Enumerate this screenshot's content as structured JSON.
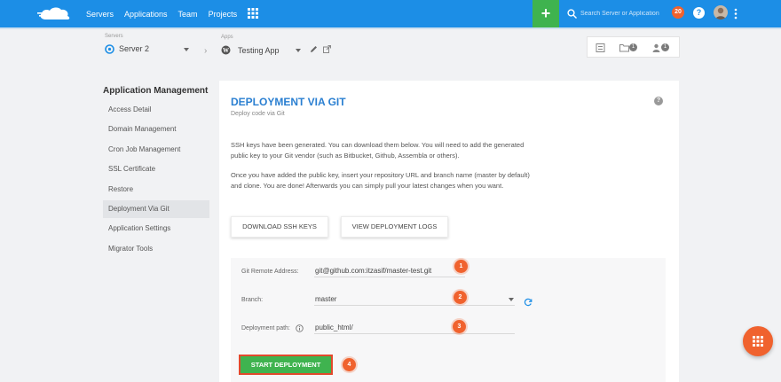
{
  "topbar": {
    "brand_color": "#1c8ee6",
    "nav": [
      "Servers",
      "Applications",
      "Team",
      "Projects"
    ],
    "search_placeholder": "Search Server or Application",
    "notifications": "20",
    "help": "?"
  },
  "breadcrumb": {
    "server_label": "Servers",
    "server_value": "Server 2",
    "app_label": "Apps",
    "app_value": "Testing App"
  },
  "tools": {
    "files_badge": "1",
    "users_badge": "1"
  },
  "sidebar": {
    "title": "Application Management",
    "items": [
      {
        "label": "Access Detail"
      },
      {
        "label": "Domain Management"
      },
      {
        "label": "Cron Job Management"
      },
      {
        "label": "SSL Certificate"
      },
      {
        "label": "Restore"
      },
      {
        "label": "Deployment Via Git"
      },
      {
        "label": "Application Settings"
      },
      {
        "label": "Migrator Tools"
      }
    ],
    "active_index": 5
  },
  "main": {
    "title": "DEPLOYMENT VIA GIT",
    "subtitle": "Deploy code via Git",
    "help": "?",
    "para1": "SSH keys have been generated. You can download them below. You will need to add the generated public key to your Git vendor (such as Bitbucket, Github, Assembla or others).",
    "para2": "Once you have added the public key, insert your repository URL and branch name (master by default) and clone. You are done! Afterwards you can simply pull your latest changes when you want.",
    "download_btn": "DOWNLOAD SSH KEYS",
    "logs_btn": "VIEW DEPLOYMENT LOGS"
  },
  "form": {
    "git_label": "Git Remote Address:",
    "git_value": "git@github.com:itzasif/master-test.git",
    "branch_label": "Branch:",
    "branch_value": "master",
    "path_label": "Deployment path:",
    "path_value": "public_html/",
    "start_btn": "START DEPLOYMENT",
    "steps": [
      "1",
      "2",
      "3",
      "4"
    ]
  },
  "colors": {
    "accent_green": "#3fb34f",
    "accent_orange": "#f0622e",
    "title_blue": "#2a7fd1"
  }
}
